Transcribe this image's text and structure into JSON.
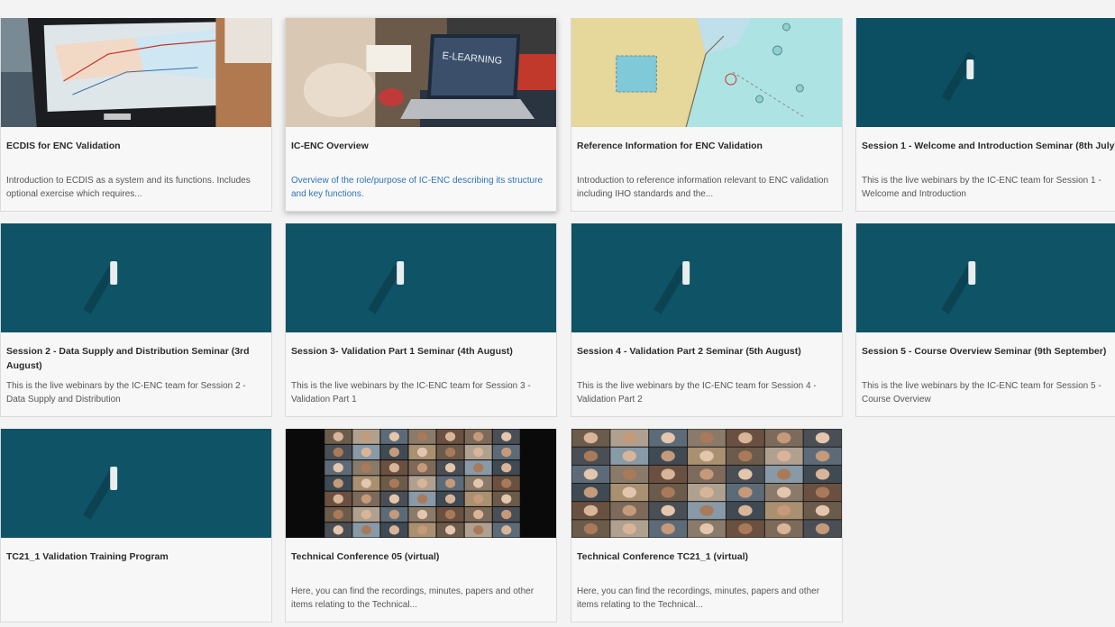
{
  "courses": [
    {
      "title": "ECDIS for ENC Validation",
      "description": "Introduction to ECDIS as a system and its functions. Includes optional exercise which requires...",
      "thumb": "ecdis-monitor"
    },
    {
      "title": "IC-ENC Overview",
      "description": "Overview of the role/purpose of IC-ENC describing its structure and key functions.",
      "thumb": "laptop-elearning",
      "thumb_text": "E-LEARNING"
    },
    {
      "title": "Reference Information for ENC Validation",
      "description": "Introduction to reference information relevant to ENC validation including IHO standards and the...",
      "thumb": "nautical-chart"
    },
    {
      "title": "Session 1 - Welcome and Introduction Seminar (8th July)",
      "description": "This is the live webinars by the IC-ENC team for Session 1 - Welcome and Introduction",
      "thumb": "sea-boat"
    },
    {
      "title": "Session 2 - Data Supply and Distribution Seminar (3rd August)",
      "description": "This is the live webinars by the IC-ENC team for Session 2 - Data Supply and Distribution",
      "thumb": "sea-boat"
    },
    {
      "title": "Session 3- Validation Part 1 Seminar (4th August)",
      "description": "This is the live webinars by the IC-ENC team for Session 3 - Validation Part 1",
      "thumb": "sea-boat"
    },
    {
      "title": "Session 4 - Validation Part 2 Seminar (5th August)",
      "description": "This is the live webinars by the IC-ENC team for Session 4 - Validation Part 2",
      "thumb": "sea-boat"
    },
    {
      "title": "Session 5 - Course Overview Seminar (9th September)",
      "description": "This is the live webinars by the IC-ENC team for Session 5 - Course Overview",
      "thumb": "sea-boat"
    },
    {
      "title": "TC21_1 Validation Training Program",
      "description": "",
      "thumb": "sea-boat"
    },
    {
      "title": "Technical Conference 05 (virtual)",
      "description": "Here, you can find the recordings, minutes, papers and other items relating to the Technical...",
      "thumb": "video-grid-dark"
    },
    {
      "title": "Technical Conference TC21_1 (virtual)",
      "description": "Here, you can find the recordings, minutes, papers and other items relating to the Technical...",
      "thumb": "video-grid-full"
    }
  ],
  "colors": {
    "sea": "#0f5366",
    "land": "#e6d79a",
    "water": "#aee3e3",
    "link": "#2f74b5"
  }
}
